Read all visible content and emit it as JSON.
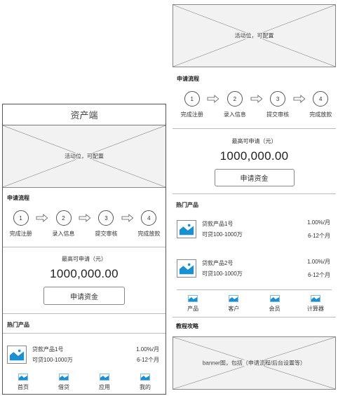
{
  "header": {
    "title": "资产端"
  },
  "activity_banner": {
    "label": "活动位，可配置"
  },
  "flow": {
    "title": "申请流程",
    "steps": [
      {
        "num": "1",
        "label": "完成注册"
      },
      {
        "num": "2",
        "label": "录入信息"
      },
      {
        "num": "3",
        "label": "提交审核"
      },
      {
        "num": "4",
        "label": "完成放款"
      }
    ]
  },
  "quota": {
    "label": "最高可申请（元）",
    "amount": "1000,000.00",
    "button": "申请资金"
  },
  "hot_products": {
    "title": "热门产品",
    "items": [
      {
        "name": "贷款产品1号",
        "range": "可贷100-1000万",
        "rate": "1.00%/月",
        "term": "6-12个月"
      },
      {
        "name": "贷款产品2号",
        "range": "可贷100-1000万",
        "rate": "1.00%/月",
        "term": "6-12个月"
      }
    ]
  },
  "bottom_nav": {
    "items": [
      {
        "label": "首页",
        "icon": "image-icon"
      },
      {
        "label": "借贷",
        "icon": "image-icon"
      },
      {
        "label": "应用",
        "icon": "image-icon"
      },
      {
        "label": "我的",
        "icon": "image-icon"
      }
    ]
  },
  "category_nav": {
    "items": [
      {
        "label": "产品",
        "icon": "image-icon"
      },
      {
        "label": "客户",
        "icon": "image-icon"
      },
      {
        "label": "会员",
        "icon": "image-icon"
      },
      {
        "label": "计算器",
        "icon": "image-icon"
      }
    ]
  },
  "tutorial": {
    "title": "教程攻略",
    "banner_label": "banner图，包括（申请流程/后台设置等）"
  },
  "colors": {
    "accent_blue": "#1a8fd1",
    "border": "#555555",
    "placeholder_bg": "#f2f2f2"
  }
}
